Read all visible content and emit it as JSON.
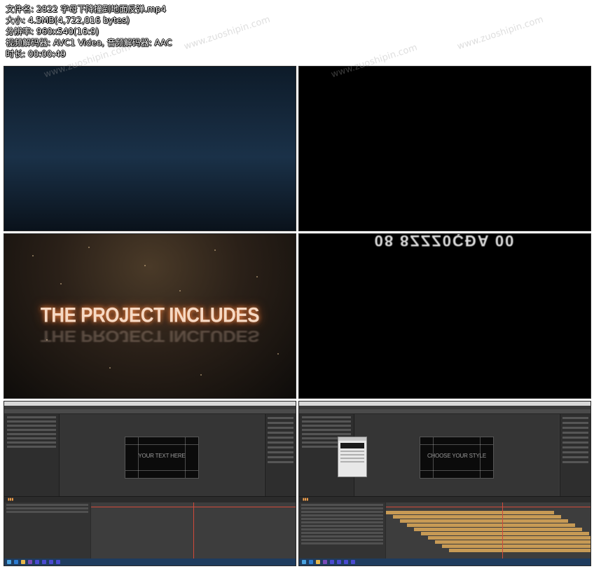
{
  "file_info": {
    "filename": "文件名: 2822 字母下降撞到地面反弹.mp4",
    "size": "大小: 4.5MB(4,722,016 bytes)",
    "resolution": "分辨率: 960x540(16:9)",
    "codec": "视频解码器: AVC1 Video, 音频解码器: AAC",
    "duration": "时长: 00:00:49"
  },
  "watermark": "www.zuoshipin.com",
  "frames": {
    "f3_title": "THE PROJECT INCLUDES",
    "f4_falling_letters": "08 8ZZZ0ÇÐA 00",
    "f5_canvas_text": "YOUR TEXT HERE",
    "f6_canvas_text": "CHOOSE YOUR STYLE"
  },
  "colors": {
    "ae_panel": "#3b3b3b",
    "timeline_marker": "#d04a3a",
    "title_glow": "#ff8c46"
  }
}
